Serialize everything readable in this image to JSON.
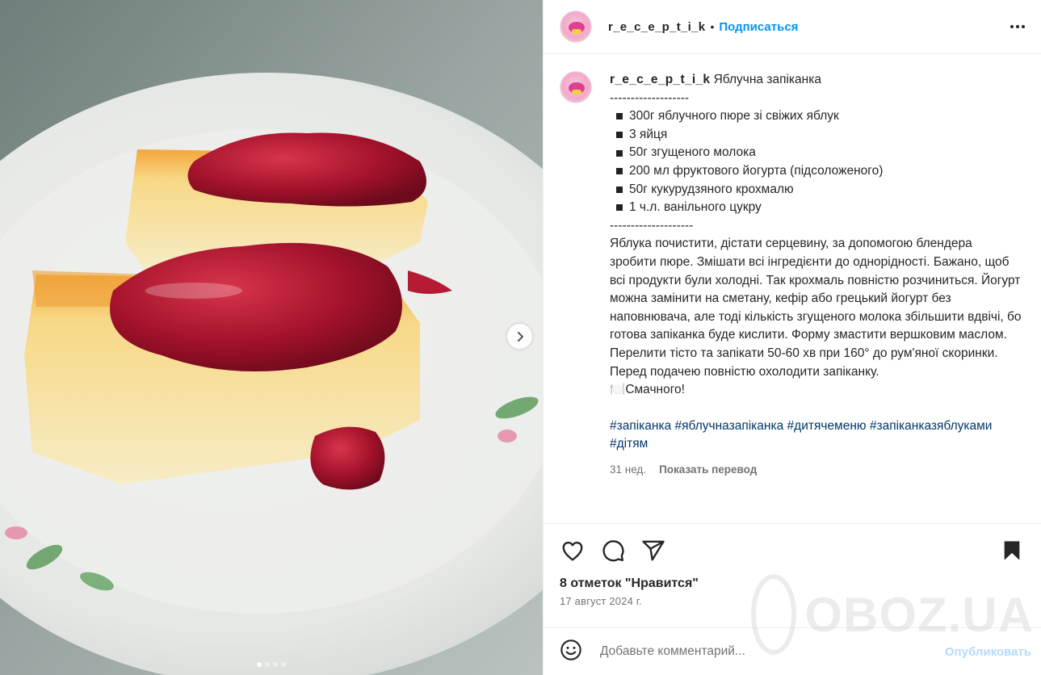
{
  "post": {
    "username": "r_e_c_e_p_t_i_k",
    "separator": "•",
    "follow_label": "Подписаться",
    "more_icon": "more-horizontal-icon"
  },
  "media": {
    "image_alt": "cheesecake-slices-with-jam-photo",
    "next_icon": "chevron-right-icon",
    "carousel_count": 4,
    "carousel_active": 1
  },
  "caption": {
    "username": "r_e_c_e_p_t_i_k",
    "title": "Яблучна запіканка",
    "divider_top": "-------------------",
    "ingredients": [
      "300г яблучного пюре зі свіжих яблук",
      "3 яйця",
      "50г згущеного молока",
      "200 мл фруктового йогурта (підсоложеного)",
      "50г кукурудзяного крохмалю",
      "1 ч.л. ванільного цукру"
    ],
    "divider_bottom": "--------------------",
    "instructions": "Яблука почистити, дістати серцевину, за допомогою блендера зробити пюре. Змішати всі інгредієнти до однорідності. Бажано, щоб всі продукти були холодні. Так крохмаль повністю розчиниться. Йогурт можна замінити на сметану, кефір або грецький йогурт без наповнювача, але тоді кількість згущеного молока збільшити вдвічі, бо готова запіканка буде кислити. Форму змастити вершковим маслом. Перелити тісто та запікати 50-60 хв при 160° до рум'яної скоринки. Перед подачею повністю охолодити запіканку.",
    "closing_emoji": "🍽️",
    "closing": "Смачного!",
    "hashtags": [
      "#запіканка",
      "#яблучназапіканка",
      "#дитячеменю",
      "#запіканказяблуками",
      "#дітям"
    ],
    "age": "31 нед.",
    "translate_label": "Показать перевод"
  },
  "actions": {
    "like_icon": "heart-icon",
    "comment_icon": "comment-icon",
    "share_icon": "share-icon",
    "save_icon": "bookmark-icon",
    "likes_text": "8 отметок \"Нравится\"",
    "date_text": "17 август 2024 г."
  },
  "comment": {
    "emoji_icon": "smiley-icon",
    "placeholder": "Добавьте комментарий...",
    "publish_label": "Опубликовать"
  },
  "watermark": {
    "text": "OBOZ.UA"
  },
  "colors": {
    "link_blue": "#0095f6",
    "hashtag": "#00376b",
    "muted": "#737373",
    "publish_disabled": "#b3dbff"
  }
}
